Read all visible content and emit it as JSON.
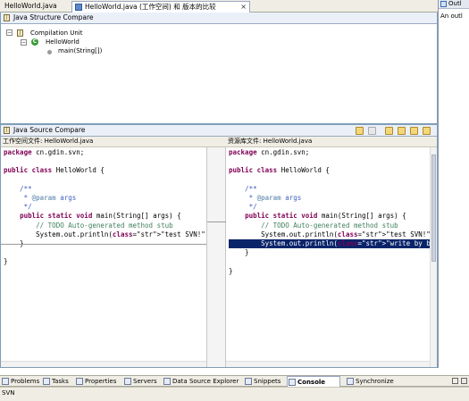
{
  "editor_tabs": [
    {
      "label": "HelloWorld.java"
    },
    {
      "label": "HelloWorld.java (工作空间) 和 版本的比较"
    }
  ],
  "outline": {
    "title": "Outl",
    "message": "An outl"
  },
  "structure_compare": {
    "title": "Java Structure Compare",
    "tree": [
      "Compilation Unit",
      "HelloWorld",
      "main(String[])"
    ]
  },
  "source_compare": {
    "title": "Java Source Compare",
    "left_header": "工作空间文件: HelloWorld.java",
    "right_header": "资源库文件: HelloWorld.java"
  },
  "code_left": [
    "package cn.gdin.svn;",
    "",
    "public class HelloWorld {",
    "",
    "    /**",
    "     * @param args",
    "     */",
    "    public static void main(String[] args) {",
    "        // TODO Auto-generated method stub",
    "        System.out.println(\"test SVN!\");",
    "    }",
    "",
    "}"
  ],
  "code_right": [
    "package cn.gdin.svn;",
    "",
    "public class HelloWorld {",
    "",
    "    /**",
    "     * @param args",
    "     */",
    "    public static void main(String[] args) {",
    "        // TODO Auto-generated method stub",
    "        System.out.println(\"test SVN!\");",
    "        System.out.println(\"write by b!\");",
    "    }",
    "",
    "}"
  ],
  "bottom_tabs": [
    "Problems",
    "Tasks",
    "Properties",
    "Servers",
    "Data Source Explorer",
    "Snippets",
    "Console",
    "Synchronize"
  ],
  "status": "SVN"
}
